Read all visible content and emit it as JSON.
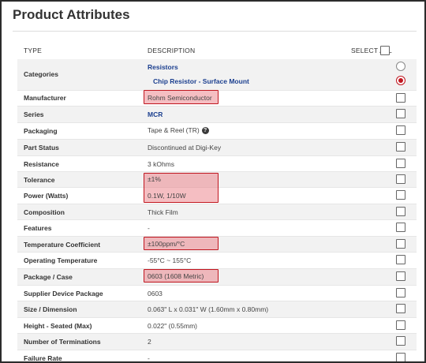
{
  "page": {
    "title": "Product Attributes"
  },
  "header": {
    "type": "TYPE",
    "description": "DESCRIPTION",
    "select_all": "SELECT ALL"
  },
  "rows": {
    "categories": {
      "label": "Categories",
      "value1": "Resistors",
      "value2": "Chip Resistor - Surface Mount"
    },
    "manufacturer": {
      "label": "Manufacturer",
      "value": "Rohm Semiconductor"
    },
    "series": {
      "label": "Series",
      "value": "MCR"
    },
    "packaging": {
      "label": "Packaging",
      "value": "Tape & Reel (TR)",
      "help": "?"
    },
    "part_status": {
      "label": "Part Status",
      "value": "Discontinued at Digi-Key"
    },
    "resistance": {
      "label": "Resistance",
      "value": "3 kOhms"
    },
    "tolerance": {
      "label": "Tolerance",
      "value": "±1%"
    },
    "power": {
      "label": "Power (Watts)",
      "value": "0.1W, 1/10W"
    },
    "composition": {
      "label": "Composition",
      "value": "Thick Film"
    },
    "features": {
      "label": "Features",
      "value": "-"
    },
    "temp_coeff": {
      "label": "Temperature Coefficient",
      "value": "±100ppm/°C"
    },
    "op_temp": {
      "label": "Operating Temperature",
      "value": "-55°C ~ 155°C"
    },
    "package": {
      "label": "Package / Case",
      "value": "0603 (1608 Metric)"
    },
    "supplier_pkg": {
      "label": "Supplier Device Package",
      "value": "0603"
    },
    "size": {
      "label": "Size / Dimension",
      "value": "0.063\" L x 0.031\" W (1.60mm x 0.80mm)"
    },
    "height": {
      "label": "Height - Seated (Max)",
      "value": "0.022\" (0.55mm)"
    },
    "terminations": {
      "label": "Number of Terminations",
      "value": "2"
    },
    "failure_rate": {
      "label": "Failure Rate",
      "value": "-"
    }
  },
  "highlight_color": "#c0161f",
  "link_color": "#1b3f8f"
}
